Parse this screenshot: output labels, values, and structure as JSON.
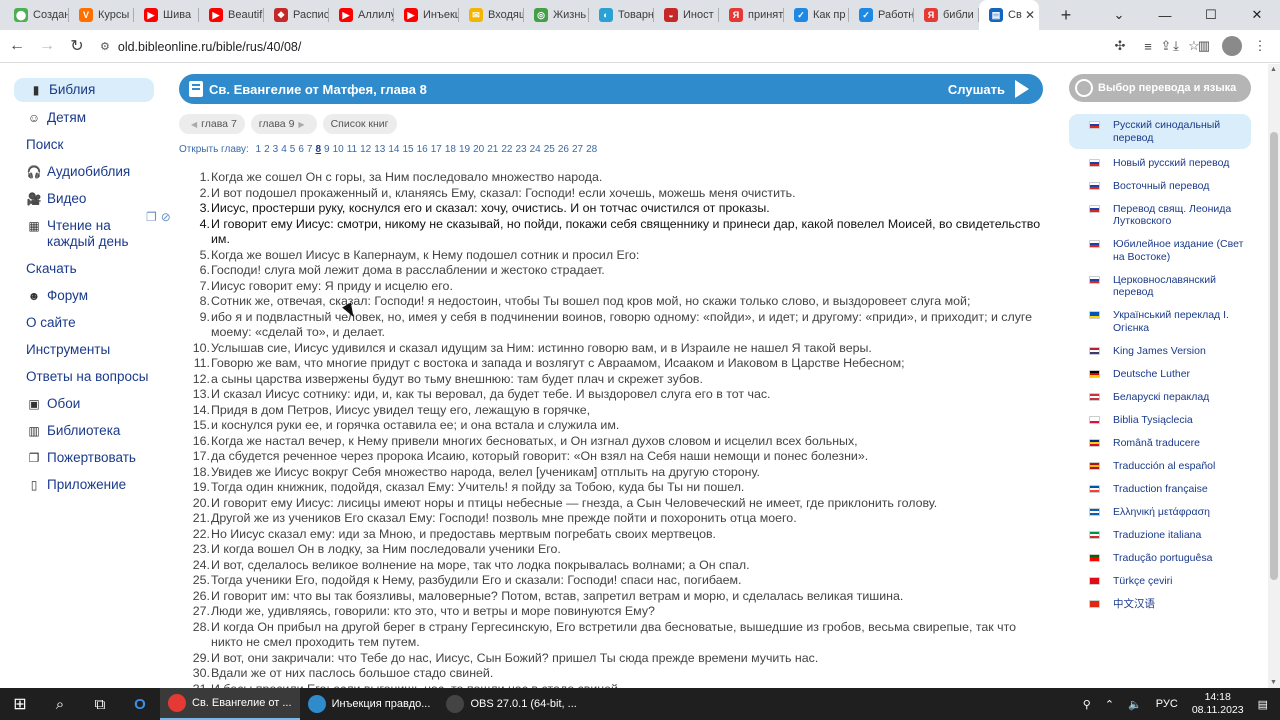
{
  "browser": {
    "tabs": [
      {
        "label": "Создан",
        "color": "#4caf50",
        "glyph": "⬤"
      },
      {
        "label": "Курсы",
        "color": "#ff6f00",
        "glyph": "V"
      },
      {
        "label": "Шива",
        "color": "#ff0000",
        "glyph": "▶"
      },
      {
        "label": "Beautif",
        "color": "#ff0000",
        "glyph": "▶"
      },
      {
        "label": "Распис",
        "color": "#c62828",
        "glyph": "❖"
      },
      {
        "label": "Аллилу",
        "color": "#ff0000",
        "glyph": "▶"
      },
      {
        "label": "Инъекц",
        "color": "#ff0000",
        "glyph": "▶"
      },
      {
        "label": "Входящ",
        "color": "#f4b400",
        "glyph": "✉"
      },
      {
        "label": "Жизнь",
        "color": "#43a047",
        "glyph": "◎"
      },
      {
        "label": "Товарн",
        "color": "#2aa1d5",
        "glyph": "◐"
      },
      {
        "label": "Иност",
        "color": "#c62828",
        "glyph": "◒"
      },
      {
        "label": "принят",
        "color": "#e53935",
        "glyph": "Я"
      },
      {
        "label": "Как пр",
        "color": "#1e88e5",
        "glyph": "✓"
      },
      {
        "label": "Работн",
        "color": "#1e88e5",
        "glyph": "✓"
      },
      {
        "label": "библи",
        "color": "#e53935",
        "glyph": "Я"
      }
    ],
    "active_tab": {
      "label": "Св",
      "color": "#1565c0",
      "glyph": "▤"
    },
    "new_tab": "+",
    "url": "old.bibleonline.ru/bible/rus/40/08/"
  },
  "sidebar": {
    "items": [
      {
        "label": "Библия",
        "icon": "▮",
        "icon_name": "bible-icon",
        "active": true
      },
      {
        "label": "Детям",
        "icon": "☺",
        "icon_name": "kids-icon"
      },
      {
        "label": "Поиск",
        "icon": "",
        "icon_name": ""
      },
      {
        "label": "Аудиобиблия",
        "icon": "🎧",
        "icon_name": "headphones-icon"
      },
      {
        "label": "Видео",
        "icon": "🎥",
        "icon_name": "video-icon"
      },
      {
        "label": "Чтение на каждый день",
        "icon": "▦",
        "icon_name": "calendar-icon"
      },
      {
        "label": "Скачать",
        "icon": "",
        "icon_name": ""
      },
      {
        "label": "Форум",
        "icon": "☻",
        "icon_name": "forum-icon"
      },
      {
        "label": "О сайте",
        "icon": "",
        "icon_name": ""
      },
      {
        "label": "Инструменты",
        "icon": "",
        "icon_name": ""
      },
      {
        "label": "Ответы на вопросы",
        "icon": "",
        "icon_name": ""
      },
      {
        "label": "Обои",
        "icon": "▣",
        "icon_name": "wallpaper-icon"
      },
      {
        "label": "Библиотека",
        "icon": "▥",
        "icon_name": "library-icon"
      },
      {
        "label": "Пожертвовать",
        "icon": "❐",
        "icon_name": "donate-icon"
      },
      {
        "label": "Приложение",
        "icon": "▯",
        "icon_name": "phone-icon"
      }
    ]
  },
  "main": {
    "title": "Св. Евангелие от Матфея, глава 8",
    "listen": "Слушать",
    "prev_chapter": "глава 7",
    "next_chapter": "глава 9",
    "books_list": "Список книг",
    "open_chapter_label": "Открыть главу:",
    "chapters": [
      "1",
      "2",
      "3",
      "4",
      "5",
      "6",
      "7",
      "8",
      "9",
      "10",
      "11",
      "12",
      "13",
      "14",
      "15",
      "16",
      "17",
      "18",
      "19",
      "20",
      "21",
      "22",
      "23",
      "24",
      "25",
      "26",
      "27",
      "28"
    ],
    "current_chapter": "8",
    "verses": [
      {
        "n": "1.",
        "t": "Когда же сошел Он с горы, за Ним последовало множество народа."
      },
      {
        "n": "2.",
        "t": "И вот подошел прокаженный и, кланяясь Ему, сказал: Господи! если хочешь, можешь меня очистить."
      },
      {
        "n": "3.",
        "t": "Иисус, простерши руку, коснулся его и сказал: хочу, очистись. И он тотчас очистился от проказы.",
        "hl": true
      },
      {
        "n": "4.",
        "t": "И говорит ему Иисус: смотри, никому не сказывай, но пойди, покажи себя священнику и принеси дар, какой повелел Моисей, во свидетельство им.",
        "hl": true
      },
      {
        "n": "5.",
        "t": "Когда же вошел Иисус в Капернаум, к Нему подошел сотник и просил Его:"
      },
      {
        "n": "6.",
        "t": "Господи! слуга мой лежит дома в расслаблении и жестоко страдает."
      },
      {
        "n": "7.",
        "t": "Иисус говорит ему: Я приду и исцелю его."
      },
      {
        "n": "8.",
        "t": "Сотник же, отвечая, сказал: Господи! я недостоин, чтобы Ты вошел под кров мой, но скажи только слово, и выздоровеет слуга мой;"
      },
      {
        "n": "9.",
        "t": "ибо я и подвластный человек, но, имея у себя в подчинении воинов, говорю одному: «пойди», и идет; и другому: «приди», и приходит; и слуге моему: «сделай то», и делает."
      },
      {
        "n": "10.",
        "t": "Услышав сие, Иисус удивился и сказал идущим за Ним: истинно говорю вам, и в Израиле не нашел Я такой веры."
      },
      {
        "n": "11.",
        "t": "Говорю же вам, что многие придут с востока и запада и возлягут с Авраамом, Исааком и Иаковом в Царстве Небесном;"
      },
      {
        "n": "12.",
        "t": "а сыны царства извержены будут во тьму внешнюю: там будет плач и скрежет зубов."
      },
      {
        "n": "13.",
        "t": "И сказал Иисус сотнику: иди, и, как ты веровал, да будет тебе. И выздоровел слуга его в тот час."
      },
      {
        "n": "14.",
        "t": "Придя в дом Петров, Иисус увидел тещу его, лежащую в горячке,"
      },
      {
        "n": "15.",
        "t": "и коснулся руки ее, и горячка оставила ее; и она встала и служила им."
      },
      {
        "n": "16.",
        "t": "Когда же настал вечер, к Нему привели многих бесноватых, и Он изгнал духов словом и исцелил всех больных,"
      },
      {
        "n": "17.",
        "t": "да сбудется реченное через пророка Исаию, который говорит: «Он взял на Себя наши немощи и понес болезни»."
      },
      {
        "n": "18.",
        "t": "Увидев же Иисус вокруг Себя множество народа, велел [ученикам] отплыть на другую сторону."
      },
      {
        "n": "19.",
        "t": "Тогда один книжник, подойдя, сказал Ему: Учитель! я пойду за Тобою, куда бы Ты ни пошел."
      },
      {
        "n": "20.",
        "t": "И говорит ему Иисус: лисицы имеют норы и птицы небесные — гнезда, а Сын Человеческий не имеет, где приклонить голову."
      },
      {
        "n": "21.",
        "t": "Другой же из учеников Его сказал Ему: Господи! позволь мне прежде пойти и похоронить отца моего."
      },
      {
        "n": "22.",
        "t": "Но Иисус сказал ему: иди за Мною, и предоставь мертвым погребать своих мертвецов."
      },
      {
        "n": "23.",
        "t": "И когда вошел Он в лодку, за Ним последовали ученики Его."
      },
      {
        "n": "24.",
        "t": "И вот, сделалось великое волнение на море, так что лодка покрывалась волнами; а Он спал."
      },
      {
        "n": "25.",
        "t": "Тогда ученики Его, подойдя к Нему, разбудили Его и сказали: Господи! спаси нас, погибаем."
      },
      {
        "n": "26.",
        "t": "И говорит им: что вы так боязливы, маловерные? Потом, встав, запретил ветрам и морю, и сделалась великая тишина."
      },
      {
        "n": "27.",
        "t": "Люди же, удивляясь, говорили: кто это, что и ветры и море повинуются Ему?"
      },
      {
        "n": "28.",
        "t": "И когда Он прибыл на другой берег в страну Гергесинскую, Его встретили два бесноватые, вышедшие из гробов, весьма свирепые, так что никто не смел проходить тем путем."
      },
      {
        "n": "29.",
        "t": "И вот, они закричали: что Тебе до нас, Иисус, Сын Божий? пришел Ты сюда прежде времени мучить нас."
      },
      {
        "n": "30.",
        "t": "Вдали же от них паслось большое стадо свиней."
      },
      {
        "n": "31.",
        "t": "И бесы просили Его: если выгонишь нас, то пошли нас в стадо свиней."
      }
    ]
  },
  "right": {
    "choose_label": "Выбор перевода и языка",
    "translations": [
      {
        "label": "Русский синодальный перевод",
        "flag": [
          "#ffffff",
          "#1c3faa",
          "#d52b1e"
        ],
        "active": true
      },
      {
        "label": "Новый русский перевод",
        "flag": [
          "#ffffff",
          "#1c3faa",
          "#d52b1e"
        ]
      },
      {
        "label": "Восточный перевод",
        "flag": [
          "#ffffff",
          "#1c3faa",
          "#d52b1e"
        ]
      },
      {
        "label": "Перевод свящ. Леонида Лутковского",
        "flag": [
          "#ffffff",
          "#1c3faa",
          "#d52b1e"
        ]
      },
      {
        "label": "Юбилейное издание (Свет на Востоке)",
        "flag": [
          "#ffffff",
          "#1c3faa",
          "#d52b1e"
        ]
      },
      {
        "label": "Церковнославянский перевод",
        "flag": [
          "#ffffff",
          "#1c3faa",
          "#d52b1e"
        ]
      },
      {
        "label": "Український переклад І. Огієнка",
        "flag": [
          "#0057b7",
          "#0057b7",
          "#ffd700"
        ]
      },
      {
        "label": "King James Version",
        "flag": [
          "#b22234",
          "#ffffff",
          "#3c3b6e"
        ]
      },
      {
        "label": "Deutsche Luther",
        "flag": [
          "#000000",
          "#dd0000",
          "#ffce00"
        ]
      },
      {
        "label": "Беларускі пераклад",
        "flag": [
          "#c8313e",
          "#ffffff",
          "#c8313e"
        ]
      },
      {
        "label": "Biblia Tysiąclecia",
        "flag": [
          "#ffffff",
          "#ffffff",
          "#dc143c"
        ]
      },
      {
        "label": "Română traducere",
        "flag": [
          "#002b7f",
          "#fcd116",
          "#ce1126"
        ]
      },
      {
        "label": "Traducción al español",
        "flag": [
          "#aa151b",
          "#f1bf00",
          "#aa151b"
        ]
      },
      {
        "label": "Traduction française",
        "flag": [
          "#0055a4",
          "#ffffff",
          "#ef4135"
        ]
      },
      {
        "label": "Ελληνική μετάφραση",
        "flag": [
          "#0d5eaf",
          "#ffffff",
          "#0d5eaf"
        ]
      },
      {
        "label": "Traduzione italiana",
        "flag": [
          "#009246",
          "#ffffff",
          "#ce2b37"
        ]
      },
      {
        "label": "Tradução portuguêsa",
        "flag": [
          "#006600",
          "#ff0000",
          "#ff0000"
        ]
      },
      {
        "label": "Türkçe çeviri",
        "flag": [
          "#e30a17",
          "#e30a17",
          "#e30a17"
        ]
      },
      {
        "label": "中文汉语",
        "flag": [
          "#de2910",
          "#de2910",
          "#de2910"
        ]
      }
    ]
  },
  "taskbar": {
    "apps": [
      {
        "label": "Св. Евангелие от ...",
        "color": "#e53935",
        "active": true
      },
      {
        "label": "Инъекция правдо...",
        "color": "#2f8bcc"
      },
      {
        "label": "OBS 27.0.1 (64-bit, ...",
        "color": "#444444"
      }
    ],
    "lang": "РУС",
    "time": "14:18",
    "date": "08.11.2023"
  }
}
